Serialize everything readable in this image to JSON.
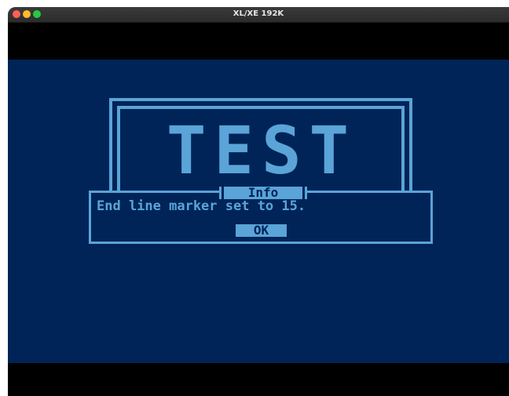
{
  "window": {
    "title": "XL/XE 192K"
  },
  "screen": {
    "banner_text": "TEST",
    "colors": {
      "background": "#002458",
      "foreground": "#5aa4d8"
    }
  },
  "dialog": {
    "title": "Info",
    "message": "End line marker set to 15.",
    "ok_label": "OK"
  }
}
